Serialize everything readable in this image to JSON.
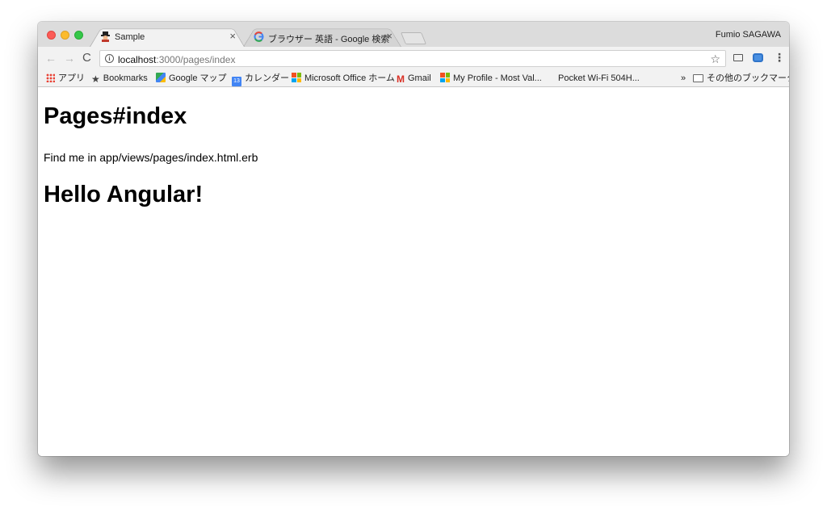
{
  "browser": {
    "profile_name": "Fumio SAGAWA",
    "tabs": [
      {
        "title": "Sample",
        "favicon": "app-favicon-icon",
        "close": "×"
      },
      {
        "title": "ブラウザー 英語 - Google 検索",
        "favicon": "google-g-icon",
        "close": "×"
      }
    ],
    "toolbar": {
      "back": "←",
      "forward": "→",
      "reload": "C",
      "url_host": "localhost",
      "url_path": ":3000/pages/index",
      "bookmark_star": "☆",
      "menu": "⋮"
    },
    "bookmarks": [
      {
        "label": "アプリ",
        "icon": "apps-grid-icon"
      },
      {
        "label": "Bookmarks",
        "icon": "star-icon"
      },
      {
        "label": "Google マップ",
        "icon": "maps-icon"
      },
      {
        "label": "カレンダー",
        "icon": "calendar-icon",
        "badge": "13"
      },
      {
        "label": "Microsoft Office ホーム",
        "icon": "microsoft-icon"
      },
      {
        "label": "Gmail",
        "icon": "gmail-icon"
      },
      {
        "label": "My Profile - Most Val...",
        "icon": "microsoft-icon"
      },
      {
        "label": "Pocket Wi-Fi 504H...",
        "icon": ""
      }
    ],
    "bookmarks_overflow": "»",
    "other_bookmarks": "その他のブックマーク"
  },
  "page": {
    "heading": "Pages#index",
    "paragraph": "Find me in app/views/pages/index.html.erb",
    "angular_heading": "Hello Angular!"
  },
  "colors": {
    "close": "#fc5b57",
    "minimize": "#fcbb2d",
    "maximize": "#34c748",
    "chrome": "#f2f2f2"
  }
}
